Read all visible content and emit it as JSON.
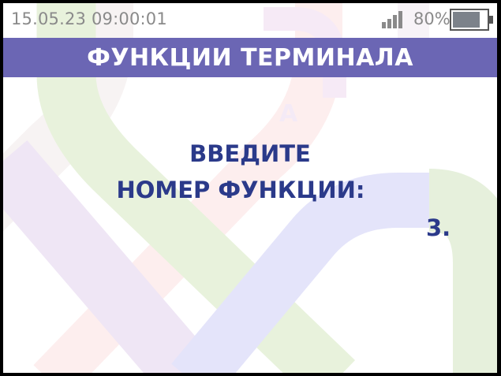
{
  "status": {
    "datetime": "15.05.23 09:00:01",
    "battery_percent": "80%",
    "signal_icon": "signal-strength-icon",
    "battery_icon": "battery-icon",
    "battery_level": 0.8
  },
  "header": {
    "title": "ФУНКЦИИ ТЕРМИНАЛА"
  },
  "main": {
    "prompt_line_1": "ВВЕДИТЕ",
    "prompt_line_2": "НОМЕР ФУНКЦИИ:",
    "input_value": "3."
  },
  "colors": {
    "header_bg": "#6b66b4",
    "prompt_text": "#2b3a8a",
    "status_text": "#8a8a8a"
  }
}
